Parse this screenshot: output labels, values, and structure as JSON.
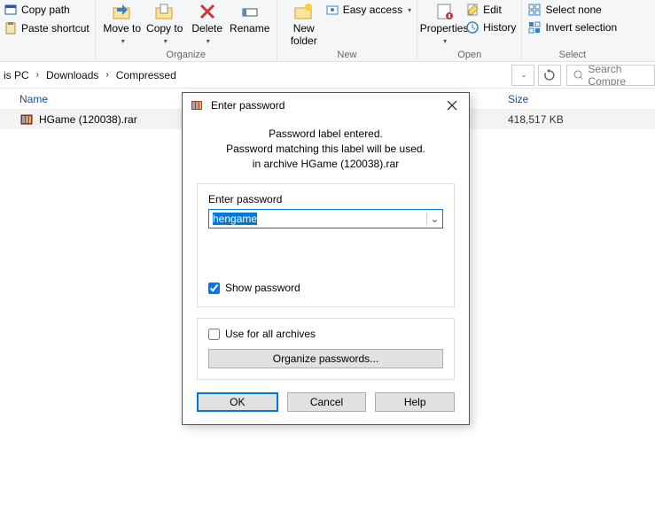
{
  "ribbon": {
    "left": {
      "copy_path": "Copy path",
      "paste_shortcut": "Paste shortcut"
    },
    "organize": {
      "move_to": "Move\nto",
      "copy_to": "Copy\nto",
      "delete": "Delete",
      "rename": "Rename",
      "group_label": "Organize"
    },
    "new": {
      "new_folder": "New\nfolder",
      "easy_access": "Easy access",
      "group_label": "New"
    },
    "open": {
      "properties": "Properties",
      "edit": "Edit",
      "history": "History",
      "group_label": "Open"
    },
    "select": {
      "select_none": "Select none",
      "invert_selection": "Invert selection",
      "group_label": "Select"
    }
  },
  "breadcrumb": {
    "p0": "is PC",
    "p1": "Downloads",
    "p2": "Compressed"
  },
  "search": {
    "placeholder": "Search Compre"
  },
  "columns": {
    "name": "Name",
    "size": "Size"
  },
  "file": {
    "name": "HGame (120038).rar",
    "size": "418,517 KB"
  },
  "dialog": {
    "title": "Enter password",
    "msg1": "Password label entered.",
    "msg2": "Password matching this label will be used.",
    "msg3": "in archive HGame (120038).rar",
    "enter_password": "Enter password",
    "password_value": "hengame",
    "show_password": "Show password",
    "show_password_checked": true,
    "use_for_all": "Use for all archives",
    "use_for_all_checked": false,
    "organize_passwords": "Organize passwords...",
    "ok": "OK",
    "cancel": "Cancel",
    "help": "Help"
  }
}
